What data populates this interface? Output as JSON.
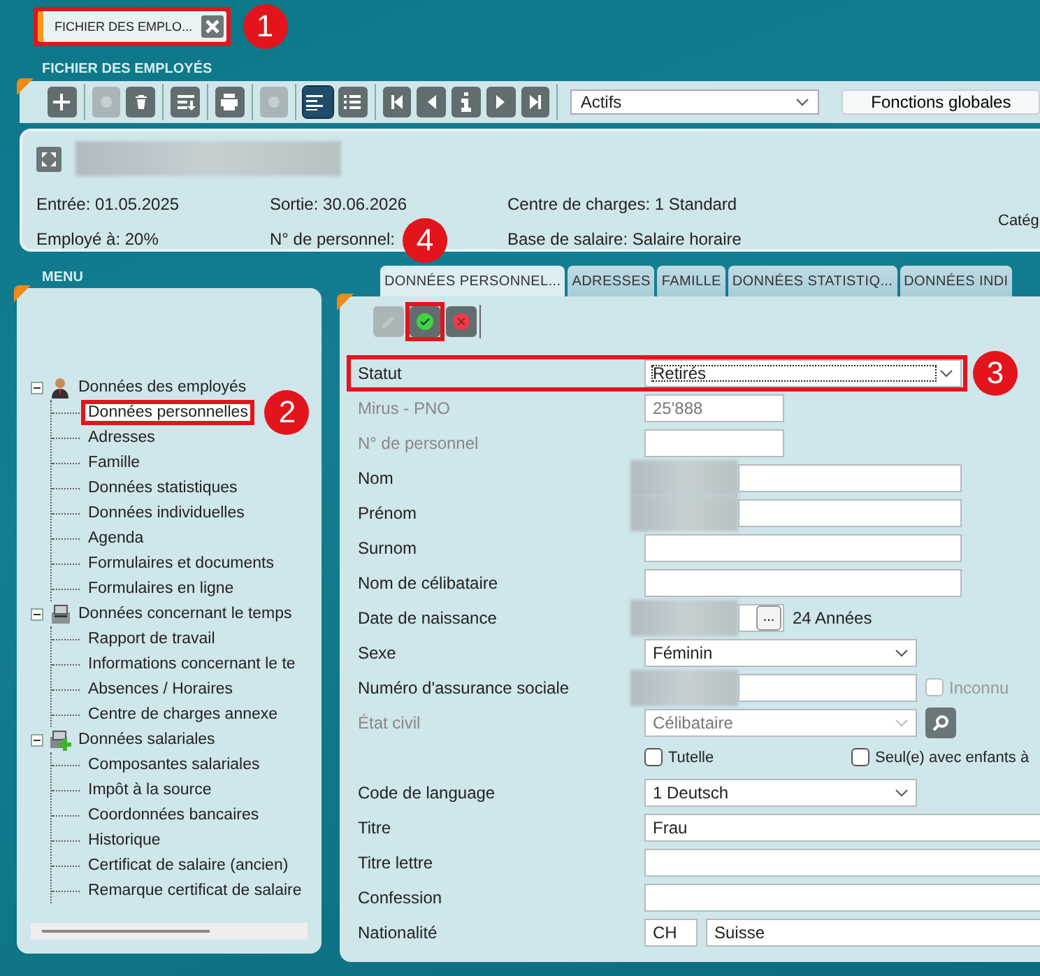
{
  "doc_tab": {
    "label": "FICHIER DES EMPLO...",
    "callout": "1"
  },
  "module_title": "FICHIER DES EMPLOYÉS",
  "toolbar": {
    "buttons": [
      {
        "kind": "add",
        "disabled": false,
        "selected": false
      },
      {
        "kind": "blank",
        "disabled": true,
        "selected": false
      },
      {
        "kind": "trash",
        "disabled": false,
        "selected": false
      },
      {
        "kind": "sort",
        "disabled": false,
        "selected": false
      },
      {
        "kind": "print",
        "disabled": false,
        "selected": false
      },
      {
        "kind": "gear",
        "disabled": true,
        "selected": false
      },
      {
        "kind": "detail",
        "disabled": false,
        "selected": true
      },
      {
        "kind": "list",
        "disabled": false,
        "selected": false
      },
      {
        "kind": "first",
        "disabled": false,
        "selected": false
      },
      {
        "kind": "prev",
        "disabled": false,
        "selected": false
      },
      {
        "kind": "info",
        "disabled": false,
        "selected": false
      },
      {
        "kind": "next",
        "disabled": false,
        "selected": false
      },
      {
        "kind": "last",
        "disabled": false,
        "selected": false
      }
    ],
    "filter": "Actifs",
    "global_button": "Fonctions globales"
  },
  "employee": {
    "fields": [
      "Entrée: 01.05.2025",
      "Sortie: 30.06.2026",
      "Centre de charges: 1 Standard",
      "Employé à: 20%",
      "N° de personnel:",
      "Base de salaire: Salaire horaire"
    ],
    "cut_label": "Catég"
  },
  "menu": {
    "title": "MENU",
    "groups": [
      {
        "label": "Données des employés",
        "expanded": true,
        "children": [
          {
            "label": "Données personnelles",
            "selected": true,
            "callout": "2"
          },
          {
            "label": "Adresses",
            "selected": false
          },
          {
            "label": "Famille",
            "selected": false
          },
          {
            "label": "Données statistiques",
            "selected": false
          },
          {
            "label": "Données individuelles",
            "selected": false
          },
          {
            "label": "Agenda",
            "selected": false
          },
          {
            "label": "Formulaires et documents",
            "selected": false
          },
          {
            "label": "Formulaires en ligne",
            "selected": false
          }
        ]
      },
      {
        "label": "Données concernant le temps",
        "expanded": true,
        "children": [
          {
            "label": "Rapport de travail",
            "selected": false
          },
          {
            "label": "Informations concernant le te",
            "selected": false
          },
          {
            "label": "Absences / Horaires",
            "selected": false
          },
          {
            "label": "Centre de charges annexe",
            "selected": false
          }
        ]
      },
      {
        "label": "Données salariales",
        "expanded": true,
        "children": [
          {
            "label": "Composantes salariales",
            "selected": false
          },
          {
            "label": "Impôt à la source",
            "selected": false
          },
          {
            "label": "Coordonnées bancaires",
            "selected": false
          },
          {
            "label": "Historique",
            "selected": false
          },
          {
            "label": "Certificat de salaire (ancien)",
            "selected": false
          },
          {
            "label": "Remarque certificat de salaire",
            "selected": false
          }
        ]
      }
    ]
  },
  "tabs": [
    {
      "label": "DONNÉES PERSONNEL...",
      "selected": true
    },
    {
      "label": "ADRESSES",
      "selected": false
    },
    {
      "label": "FAMILLE",
      "selected": false
    },
    {
      "label": "DONNÉES STATISTIQ...",
      "selected": false
    },
    {
      "label": "DONNÉES INDI",
      "selected": false
    }
  ],
  "edit_toolbar": [
    {
      "kind": "edit",
      "disabled": true
    },
    {
      "kind": "save",
      "disabled": false,
      "callout": "4"
    },
    {
      "kind": "cancel",
      "disabled": false
    }
  ],
  "form": [
    {
      "kind": "select",
      "label": "Statut",
      "value": "Retirés",
      "focused": true,
      "callout": "3"
    },
    {
      "kind": "input",
      "label": "Mirus - PNO",
      "value": "25'888",
      "disabled": true
    },
    {
      "kind": "input",
      "label": "N° de personnel",
      "disabled": true
    },
    {
      "kind": "input",
      "label": "Nom",
      "redacted": true
    },
    {
      "kind": "input",
      "label": "Prénom",
      "redacted": true
    },
    {
      "kind": "input",
      "label": "Surnom"
    },
    {
      "kind": "input",
      "label": "Nom de célibataire"
    },
    {
      "kind": "date",
      "label": "Date de naissance",
      "redacted": true,
      "button": "...",
      "note": "24 Années"
    },
    {
      "kind": "select",
      "label": "Sexe",
      "value": "Féminin"
    },
    {
      "kind": "input",
      "label": "Numéro d'assurance sociale",
      "redacted": true,
      "check": {
        "label": "Inconnu",
        "checked": false,
        "disabled": true
      }
    },
    {
      "kind": "select",
      "label": "État civil",
      "value": "Célibataire",
      "disabled": true,
      "search": true
    },
    {
      "kind": "checks",
      "checks": [
        {
          "label": "Tutelle",
          "checked": false
        },
        {
          "label": "Seul(e) avec enfants à",
          "checked": false
        }
      ]
    },
    {
      "kind": "select",
      "label": "Code de language",
      "value": "1 Deutsch"
    },
    {
      "kind": "input",
      "label": "Titre",
      "value": "Frau"
    },
    {
      "kind": "input",
      "label": "Titre lettre"
    },
    {
      "kind": "input",
      "label": "Confession"
    },
    {
      "kind": "pair",
      "label": "Nationalité",
      "code": "CH",
      "value": "Suisse"
    }
  ]
}
